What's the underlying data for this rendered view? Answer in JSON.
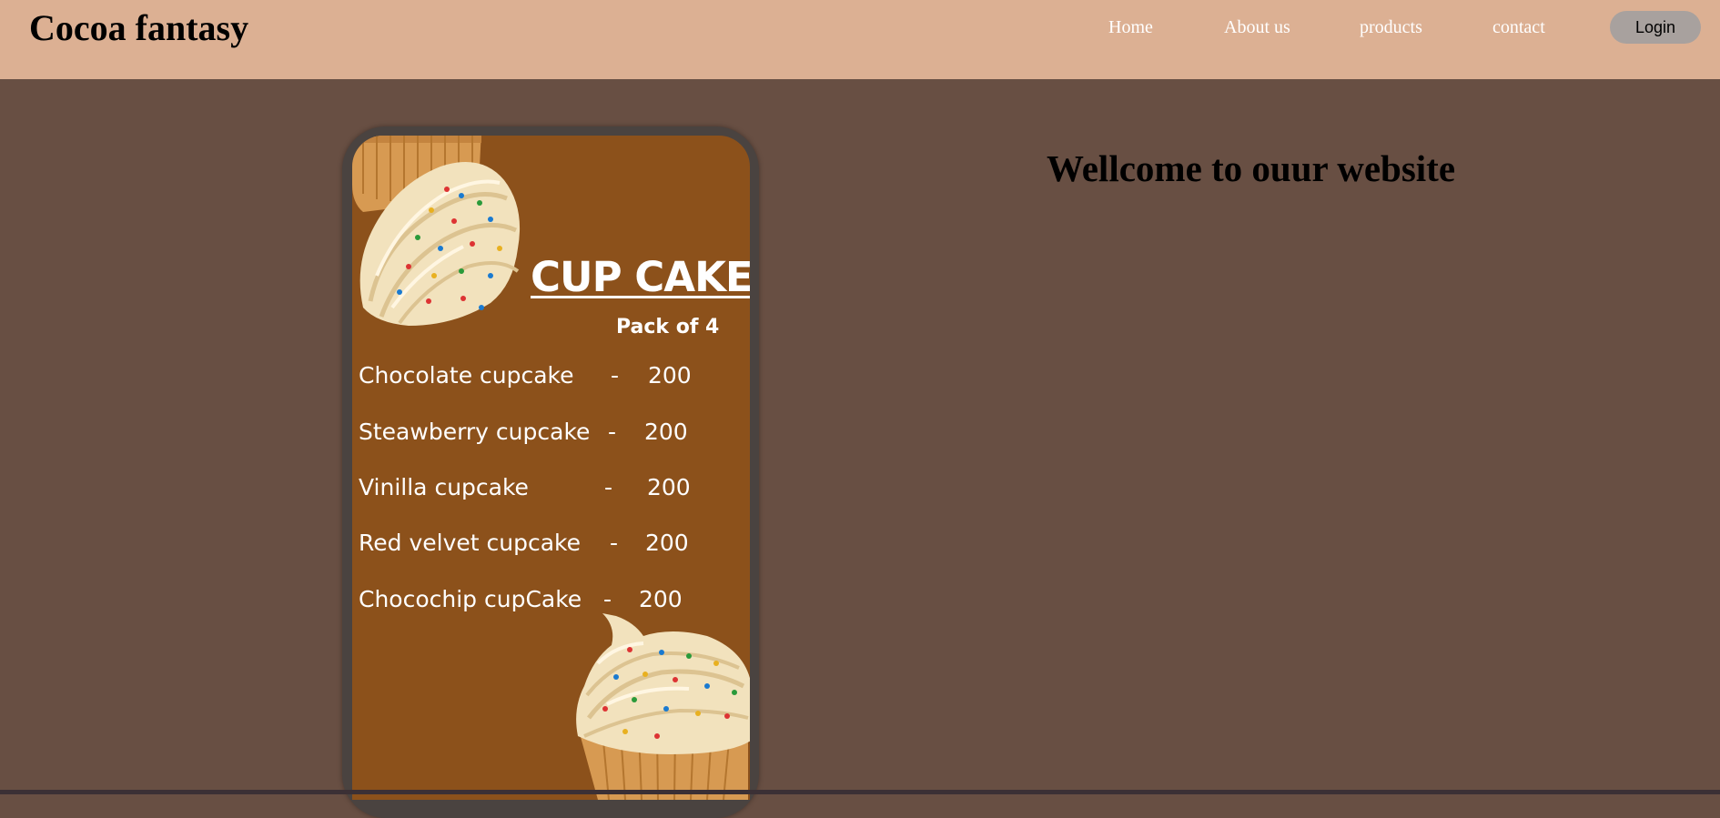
{
  "header": {
    "brand": "Cocoa fantasy",
    "nav": [
      {
        "label": "Home"
      },
      {
        "label": "About us"
      },
      {
        "label": "products"
      },
      {
        "label": "contact"
      }
    ],
    "login_label": "Login"
  },
  "menu_card": {
    "title": "CUP CAKES",
    "pack_label": "Pack of  4",
    "items": [
      {
        "name": "Chocolate cupcake",
        "sep": "-",
        "price": "200"
      },
      {
        "name": "Steawberry cupcake",
        "sep": "-",
        "price": "200"
      },
      {
        "name": "Vinilla cupcake",
        "sep": "-",
        "price": "200"
      },
      {
        "name": "Red velvet cupcake",
        "sep": "-",
        "price": "200"
      },
      {
        "name": "Chocochip cupCake",
        "sep": "-",
        "price": "200"
      }
    ]
  },
  "main": {
    "welcome": "Wellcome to ouur website"
  },
  "colors": {
    "page_bg": "#684f43",
    "navbar_bg": "#dcb093",
    "card_bg": "#8c511b",
    "phone_frame": "#4a4340",
    "login_bg": "#a8a19e"
  }
}
